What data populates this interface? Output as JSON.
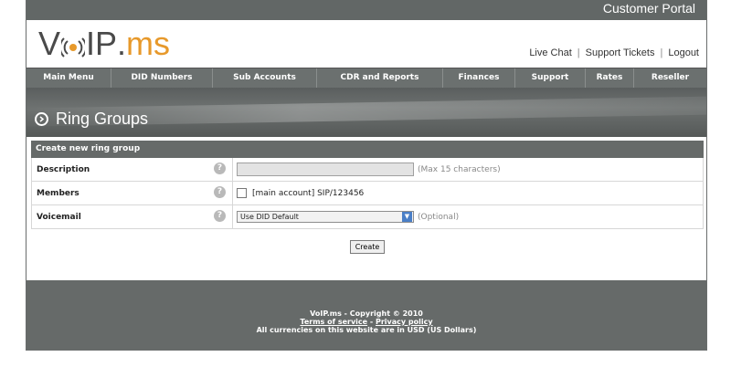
{
  "header": {
    "portal_label": "Customer Portal",
    "logo": {
      "part1": "V",
      "part2": "IP",
      "dot": ".",
      "part3": "ms"
    },
    "links": [
      "Live Chat",
      "Support Tickets",
      "Logout"
    ]
  },
  "nav": {
    "items": [
      "Main Menu",
      "DID Numbers",
      "Sub Accounts",
      "CDR and Reports",
      "Finances",
      "Support",
      "Rates",
      "Reseller"
    ]
  },
  "page": {
    "title": "Ring Groups"
  },
  "form": {
    "heading": "Create new ring group",
    "description": {
      "label": "Description",
      "value": "",
      "hint": "(Max 15 characters)"
    },
    "members": {
      "label": "Members",
      "option": "[main account] SIP/123456"
    },
    "voicemail": {
      "label": "Voicemail",
      "selected": "Use DID Default",
      "hint": "(Optional)"
    },
    "create_label": "Create"
  },
  "footer": {
    "copyright": "VoIP.ms - Copyright © 2010",
    "terms": "Terms of service",
    "dash": " - ",
    "privacy": "Privacy policy",
    "currency": "All currencies on this website are in USD (US Dollars)"
  },
  "colors": {
    "accent": "#e7992b",
    "bar": "#666a69"
  },
  "icons": {
    "help": "help-icon",
    "title": "arrow-circle-icon",
    "dropdown": "chevron-down-icon"
  }
}
